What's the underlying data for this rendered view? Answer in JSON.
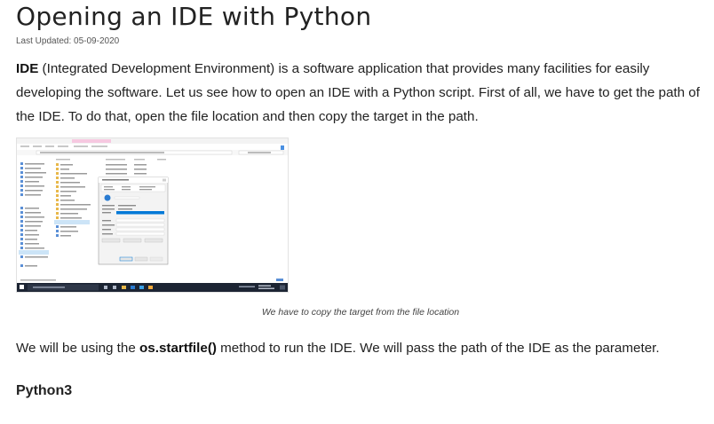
{
  "article": {
    "title": "Opening an IDE with Python",
    "last_updated": "Last Updated: 05-09-2020",
    "para1_bold": "IDE",
    "para1_rest": " (Integrated Development Environment) is a software application that provides many facilities for easily developing the software. Let us see how to open an IDE with a Python script. First of all, we have to get the path of the IDE. To do that, open the file location and then copy the target in the path.",
    "caption": "We have to copy the target from the file location",
    "para2_before": "We will be using the ",
    "para2_code": "os.startfile()",
    "para2_after": " method to run the IDE. We will pass the path of the IDE as the parameter.",
    "section_heading": "Python3"
  },
  "screenshot": {
    "dialog_title": "Jupyter Notebook Properties",
    "dialog_buttons": [
      "OK",
      "Cancel",
      "Apply"
    ],
    "taskbar_search": "Type here to search",
    "taskbar_time": "11:08",
    "taskbar_date": "05-09-2020"
  },
  "colors": {
    "text": "#222222",
    "taskbar": "#1c2433",
    "selection": "#cce4f7",
    "accent": "#0078d7"
  }
}
